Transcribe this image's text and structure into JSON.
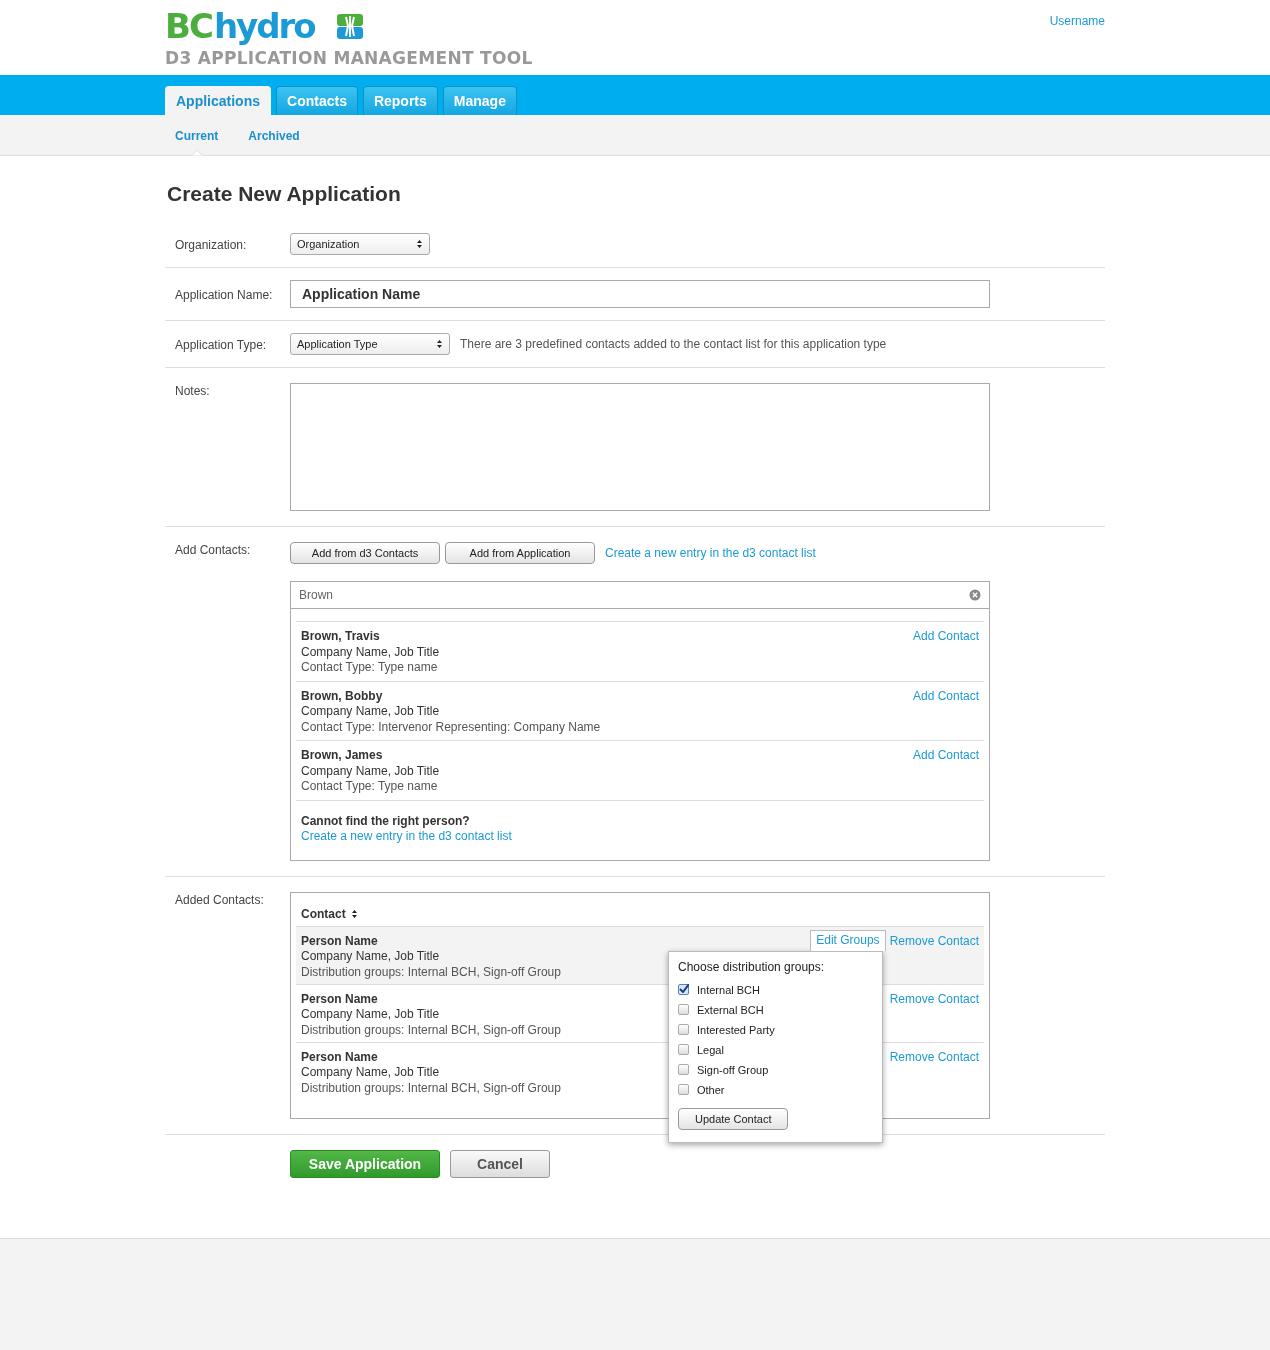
{
  "header": {
    "logo_bc": "BC",
    "logo_hydro": "hydro",
    "subtitle": "D3 APPLICATION MANAGEMENT TOOL",
    "user_link": "Username"
  },
  "tabs": [
    {
      "label": "Applications",
      "selected": true
    },
    {
      "label": "Contacts",
      "selected": false
    },
    {
      "label": "Reports",
      "selected": false
    },
    {
      "label": "Manage",
      "selected": false
    }
  ],
  "subtabs": [
    {
      "label": "Current",
      "selected": true
    },
    {
      "label": "Archived",
      "selected": false
    }
  ],
  "page_title": "Create New Application",
  "form": {
    "organization": {
      "label": "Organization:",
      "value": "Organization"
    },
    "application_name": {
      "label": "Application Name:",
      "value": "Application Name"
    },
    "application_type": {
      "label": "Application Type:",
      "value": "Application Type",
      "hint": "There are 3 predefined contacts added to the contact list for this application type"
    },
    "notes": {
      "label": "Notes:"
    },
    "add_contacts": {
      "label": "Add Contacts:",
      "buttons": [
        "Add from d3 Contacts",
        "Add from Application"
      ],
      "create_link": "Create a new entry in the d3 contact list",
      "search": {
        "value": "Brown"
      },
      "results": [
        {
          "name": "Brown, Travis",
          "company": "Company Name, Job Title",
          "type": "Contact Type: Type name",
          "action": "Add Contact"
        },
        {
          "name": "Brown, Bobby",
          "company": "Company Name, Job Title",
          "type": "Contact Type: Intervenor Representing: Company Name",
          "action": "Add Contact"
        },
        {
          "name": "Brown, James",
          "company": "Company Name, Job Title",
          "type": "Contact Type: Type name",
          "action": "Add Contact"
        }
      ],
      "not_found": {
        "question": "Cannot find the right person?",
        "link": "Create a new entry in the d3 contact list"
      }
    },
    "added_contacts": {
      "label": "Added Contacts:",
      "column": "Contact",
      "rows": [
        {
          "name": "Person Name",
          "company": "Company Name, Job Title",
          "groups": "Distribution groups: Internal BCH, Sign-off Group",
          "edit_link": "Edit Groups",
          "remove": "Remove Contact",
          "selected": true
        },
        {
          "name": "Person Name",
          "company": "Company Name, Job Title",
          "groups": "Distribution groups: Internal BCH, Sign-off Group",
          "remove": "Remove Contact",
          "selected": false
        },
        {
          "name": "Person Name",
          "company": "Company Name, Job Title",
          "groups": "Distribution groups: Internal BCH, Sign-off Group",
          "remove": "Remove Contact",
          "selected": false
        }
      ],
      "popup": {
        "title": "Choose distribution groups:",
        "button": "Update Contact",
        "options": [
          {
            "label": "Internal BCH",
            "checked": true
          },
          {
            "label": "External BCH",
            "checked": false
          },
          {
            "label": "Interested Party",
            "checked": false
          },
          {
            "label": "Legal",
            "checked": false
          },
          {
            "label": "Sign-off Group",
            "checked": false
          },
          {
            "label": "Other",
            "checked": false
          }
        ]
      }
    }
  },
  "actions": {
    "save": "Save Application",
    "cancel": "Cancel"
  }
}
